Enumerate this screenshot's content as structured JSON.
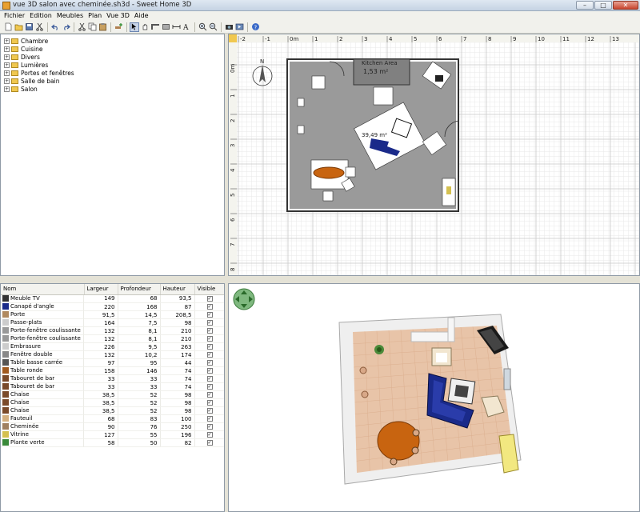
{
  "window": {
    "title": "vue 3D salon avec cheminée.sh3d - Sweet Home 3D",
    "minimize_glyph": "–",
    "maximize_glyph": "□",
    "close_glyph": "✕"
  },
  "menu": [
    "Fichier",
    "Edition",
    "Meubles",
    "Plan",
    "Vue 3D",
    "Aide"
  ],
  "toolbar": {
    "icons": [
      "new-file-icon",
      "open-icon",
      "save-icon",
      "cut-icon",
      "undo-icon",
      "redo-icon",
      "cut-icon",
      "copy-icon",
      "paste-icon",
      "add-furniture-icon",
      "select-icon",
      "pan-icon",
      "create-walls-icon",
      "create-rooms-icon",
      "create-dimensions-icon",
      "add-text-icon",
      "zoom-in-icon",
      "zoom-out-icon",
      "create-photo-icon",
      "create-video-icon",
      "help-icon"
    ]
  },
  "catalog": {
    "categories": [
      "Chambre",
      "Cuisine",
      "Divers",
      "Lumières",
      "Portes et fenêtres",
      "Salle de bain",
      "Salon"
    ],
    "expander_glyph": "+"
  },
  "furniture_table": {
    "columns": [
      "Nom",
      "Largeur",
      "Profondeur",
      "Hauteur",
      "Visible"
    ],
    "check_glyph": "✓",
    "rows": [
      {
        "name": "Meuble TV",
        "width": "149",
        "depth": "68",
        "height": "93,5",
        "icon": "tv-cabinet-icon"
      },
      {
        "name": "Canapé d'angle",
        "width": "220",
        "depth": "168",
        "height": "87",
        "icon": "sofa-icon"
      },
      {
        "name": "Porte",
        "width": "91,5",
        "depth": "14,5",
        "height": "208,5",
        "icon": "door-icon"
      },
      {
        "name": "Passe-plats",
        "width": "164",
        "depth": "7,5",
        "height": "98",
        "icon": "hatch-icon"
      },
      {
        "name": "Porte-fenêtre coulissante",
        "width": "132",
        "depth": "8,1",
        "height": "210",
        "icon": "french-window-icon"
      },
      {
        "name": "Porte-fenêtre coulissante",
        "width": "132",
        "depth": "8,1",
        "height": "210",
        "icon": "french-window-icon"
      },
      {
        "name": "Embrasure",
        "width": "226",
        "depth": "9,5",
        "height": "263",
        "icon": "opening-icon"
      },
      {
        "name": "Fenêtre double",
        "width": "132",
        "depth": "10,2",
        "height": "174",
        "icon": "window-icon"
      },
      {
        "name": "Table basse carrée",
        "width": "97",
        "depth": "95",
        "height": "44",
        "icon": "coffee-table-icon"
      },
      {
        "name": "Table ronde",
        "width": "158",
        "depth": "146",
        "height": "74",
        "icon": "round-table-icon"
      },
      {
        "name": "Tabouret de bar",
        "width": "33",
        "depth": "33",
        "height": "74",
        "icon": "bar-stool-icon"
      },
      {
        "name": "Tabouret de bar",
        "width": "33",
        "depth": "33",
        "height": "74",
        "icon": "bar-stool-icon"
      },
      {
        "name": "Chaise",
        "width": "38,5",
        "depth": "52",
        "height": "98",
        "icon": "chair-icon"
      },
      {
        "name": "Chaise",
        "width": "38,5",
        "depth": "52",
        "height": "98",
        "icon": "chair-icon"
      },
      {
        "name": "Chaise",
        "width": "38,5",
        "depth": "52",
        "height": "98",
        "icon": "chair-icon"
      },
      {
        "name": "Fauteuil",
        "width": "68",
        "depth": "83",
        "height": "100",
        "icon": "armchair-icon"
      },
      {
        "name": "Cheminée",
        "width": "90",
        "depth": "76",
        "height": "250",
        "icon": "fireplace-icon"
      },
      {
        "name": "Vitrine",
        "width": "127",
        "depth": "55",
        "height": "196",
        "icon": "display-cabinet-icon"
      },
      {
        "name": "Plante verte",
        "width": "58",
        "depth": "50",
        "height": "82",
        "icon": "plant-icon"
      }
    ]
  },
  "plan": {
    "ruler_x": [
      "-2",
      "-1",
      "0m",
      "1",
      "2",
      "3",
      "4",
      "5",
      "6",
      "7",
      "8",
      "9",
      "10",
      "11",
      "12",
      "13"
    ],
    "ruler_y": [
      "0m",
      "1",
      "2",
      "3",
      "4",
      "5",
      "6",
      "7",
      "8"
    ],
    "room_labels": {
      "kitchen_name": "Kitchen Area",
      "kitchen_area": "1,53 m²",
      "main_area": "39,49 m²"
    },
    "compass_label": "N"
  },
  "view3d": {
    "navigation_arrows": "navigation-arrows-icon"
  },
  "colors": {
    "accent_selection": "#316ac5",
    "plan_room_floor": "#9a9a9a",
    "floor_3d": "#e8c4a8",
    "sofa": "#1a2a8a",
    "table": "#c86410",
    "grid": "#dcdcdc"
  }
}
